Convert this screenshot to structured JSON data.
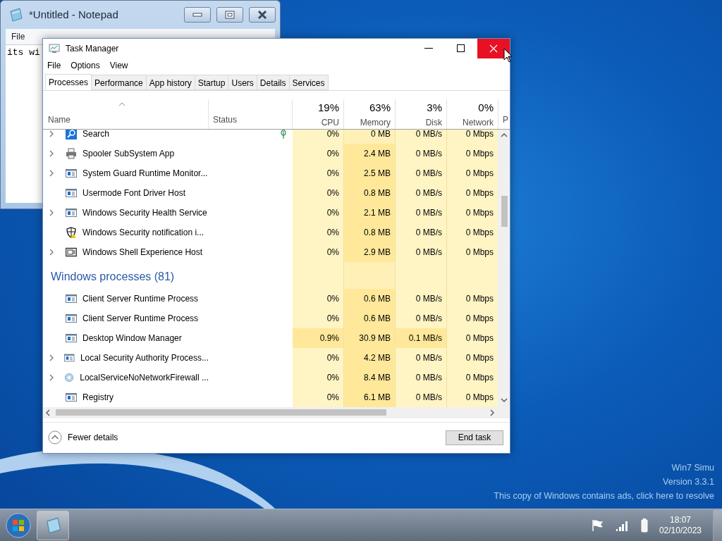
{
  "notepad": {
    "title": "*Untitled - Notepad",
    "menu": [
      "File"
    ],
    "text": "its wi"
  },
  "task_manager": {
    "title": "Task Manager",
    "menu": [
      "File",
      "Options",
      "View"
    ],
    "tabs": [
      {
        "label": "Processes",
        "selected": true
      },
      {
        "label": "Performance",
        "selected": false
      },
      {
        "label": "App history",
        "selected": false
      },
      {
        "label": "Startup",
        "selected": false
      },
      {
        "label": "Users",
        "selected": false
      },
      {
        "label": "Details",
        "selected": false
      },
      {
        "label": "Services",
        "selected": false
      }
    ],
    "columns": [
      {
        "label": "Name"
      },
      {
        "label": "Status"
      },
      {
        "percent": "19%",
        "label": "CPU"
      },
      {
        "percent": "63%",
        "label": "Memory"
      },
      {
        "percent": "3%",
        "label": "Disk"
      },
      {
        "percent": "0%",
        "label": "Network"
      },
      {
        "label": "P"
      }
    ],
    "rows": [
      {
        "kind": "process",
        "name": "Search",
        "expandable": true,
        "suspended": true,
        "cpu": "0%",
        "memory": "0 MB",
        "disk": "0 MB/s",
        "network": "0 Mbps"
      },
      {
        "kind": "process",
        "name": "Spooler SubSystem App",
        "expandable": true,
        "suspended": false,
        "cpu": "0%",
        "memory": "2.4 MB",
        "disk": "0 MB/s",
        "network": "0 Mbps"
      },
      {
        "kind": "process",
        "name": "System Guard Runtime Monitor...",
        "expandable": true,
        "suspended": false,
        "cpu": "0%",
        "memory": "2.5 MB",
        "disk": "0 MB/s",
        "network": "0 Mbps"
      },
      {
        "kind": "process",
        "name": "Usermode Font Driver Host",
        "expandable": false,
        "suspended": false,
        "cpu": "0%",
        "memory": "0.8 MB",
        "disk": "0 MB/s",
        "network": "0 Mbps"
      },
      {
        "kind": "process",
        "name": "Windows Security Health Service",
        "expandable": true,
        "suspended": false,
        "cpu": "0%",
        "memory": "2.1 MB",
        "disk": "0 MB/s",
        "network": "0 Mbps"
      },
      {
        "kind": "process",
        "name": "Windows Security notification i...",
        "expandable": false,
        "suspended": false,
        "cpu": "0%",
        "memory": "0.8 MB",
        "disk": "0 MB/s",
        "network": "0 Mbps"
      },
      {
        "kind": "process",
        "name": "Windows Shell Experience Host",
        "expandable": true,
        "suspended": false,
        "cpu": "0%",
        "memory": "2.9 MB",
        "disk": "0 MB/s",
        "network": "0 Mbps"
      },
      {
        "kind": "group",
        "name": "Windows processes (81)"
      },
      {
        "kind": "process",
        "name": "Client Server Runtime Process",
        "expandable": false,
        "suspended": false,
        "cpu": "0%",
        "memory": "0.6 MB",
        "disk": "0 MB/s",
        "network": "0 Mbps"
      },
      {
        "kind": "process",
        "name": "Client Server Runtime Process",
        "expandable": false,
        "suspended": false,
        "cpu": "0%",
        "memory": "0.6 MB",
        "disk": "0 MB/s",
        "network": "0 Mbps"
      },
      {
        "kind": "process",
        "name": "Desktop Window Manager",
        "expandable": false,
        "suspended": false,
        "cpu": "0.9%",
        "memory": "30.9 MB",
        "disk": "0.1 MB/s",
        "network": "0 Mbps"
      },
      {
        "kind": "process",
        "name": "Local Security Authority Process...",
        "expandable": true,
        "suspended": false,
        "cpu": "0%",
        "memory": "4.2 MB",
        "disk": "0 MB/s",
        "network": "0 Mbps"
      },
      {
        "kind": "process",
        "name": "LocalServiceNoNetworkFirewall ...",
        "expandable": true,
        "suspended": false,
        "cpu": "0%",
        "memory": "8.4 MB",
        "disk": "0 MB/s",
        "network": "0 Mbps"
      },
      {
        "kind": "process",
        "name": "Registry",
        "expandable": false,
        "suspended": false,
        "cpu": "0%",
        "memory": "6.1 MB",
        "disk": "0 MB/s",
        "network": "0 Mbps"
      }
    ],
    "fewer_details": "Fewer details",
    "end_task": "End task"
  },
  "desktop": {
    "notice": [
      "Win7 Simu",
      "Version 3.3.1",
      "This copy of Windows contains ads, click here to resolve"
    ]
  },
  "taskbar": {
    "time": "18:07",
    "date": "02/10/2023"
  }
}
